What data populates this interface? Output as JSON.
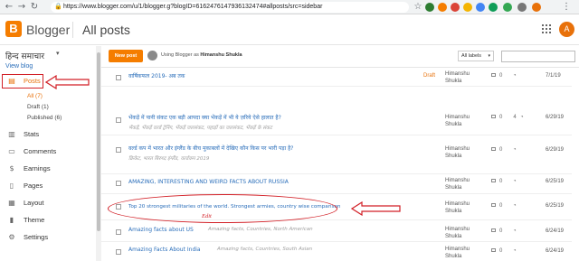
{
  "browser": {
    "url": "https://www.blogger.com/u/1/blogger.g?blogID=6162476147936132474#allposts/src=sidebar",
    "back_icon": "back-arrow-icon",
    "forward_icon": "forward-arrow-icon",
    "reload_icon": "reload-icon",
    "extensions": [
      "green",
      "orange",
      "chrome-red",
      "chrome-yellow",
      "blue-google"
    ]
  },
  "header": {
    "logo_letter": "B",
    "app_name": "Blogger",
    "page_title": "All posts",
    "avatar_letter": "A",
    "brand_color": "#f57d00"
  },
  "sidebar": {
    "blog_name": "हिन्द समाचार",
    "view_blog": "View blog",
    "posts_label": "Posts",
    "posts_sub": [
      {
        "label": "All (7)"
      },
      {
        "label": "Draft (1)"
      },
      {
        "label": "Published (6)"
      }
    ],
    "items": [
      {
        "label": "Stats",
        "icon": "stats-icon"
      },
      {
        "label": "Comments",
        "icon": "comments-icon"
      },
      {
        "label": "Earnings",
        "icon": "dollar-icon"
      },
      {
        "label": "Pages",
        "icon": "pages-icon"
      },
      {
        "label": "Layout",
        "icon": "layout-icon"
      },
      {
        "label": "Theme",
        "icon": "theme-icon"
      },
      {
        "label": "Settings",
        "icon": "settings-icon"
      }
    ]
  },
  "toolbar": {
    "new_post": "New post",
    "using_prefix": "Using Blogger as",
    "using_user": "Himanshu Shukla",
    "labels_select": "All labels",
    "search_placeholder": ""
  },
  "posts": [
    {
      "title": "वार्षिकफल 2019- अब तक",
      "labels": "",
      "status": "Draft",
      "author": "Himanshu Shukla",
      "comments": "0",
      "views": "",
      "date": "7/1/19"
    },
    {
      "title": "भेंकड़ें में पानी संकट एक बड़ी आपदा क्या भेंकड़ें में भी ये ज़रिये ऐसे हालात है?",
      "labels": "भेंकड़ें, भेंकड़ें वर्ल्ड ट्रेनिंग, भेंकड़ें जलसंकट, पहाड़ों का जलसंकट, भेंकड़ें के संकट",
      "status": "",
      "author": "Himanshu Shukla",
      "comments": "0",
      "views": "4",
      "date": "6/29/19"
    },
    {
      "title": "वर्ल्ड कप में भारत और इंग्लैंड के बीच मुकाबलों में देखिए कौन किस पर भारी पड़ा है?",
      "labels": "क्रिकेट, भारत बिरुध्द इंग्लैंड, वर्ल्डकप 2019",
      "status": "",
      "author": "Himanshu Shukla",
      "comments": "0",
      "views": "",
      "date": "6/29/19"
    },
    {
      "title": "AMAZING, INTERESTING AND WEIRD FACTS ABOUT RUSSIA",
      "labels": "",
      "status": "",
      "author": "Himanshu Shukla",
      "comments": "0",
      "views": "",
      "date": "6/25/19"
    },
    {
      "title": "Top 20 strongest militaries of the world. Strongest armies, country wise comparison",
      "labels": "",
      "status": "",
      "author": "Himanshu Shukla",
      "comments": "0",
      "views": "",
      "date": "6/25/19"
    },
    {
      "title": "Amazing facts about US",
      "labels": "Amazing facts, Countries, North American",
      "status": "",
      "author": "Himanshu Shukla",
      "comments": "0",
      "views": "",
      "date": "6/24/19"
    },
    {
      "title": "Amazing Facts About India",
      "labels": "Amazing facts, Countries, South Asian",
      "status": "",
      "author": "Himanshu Shukla",
      "comments": "0",
      "views": "",
      "date": "6/24/19"
    }
  ],
  "annotation": {
    "edit_label": "Edit",
    "accent": "#d21f26"
  }
}
